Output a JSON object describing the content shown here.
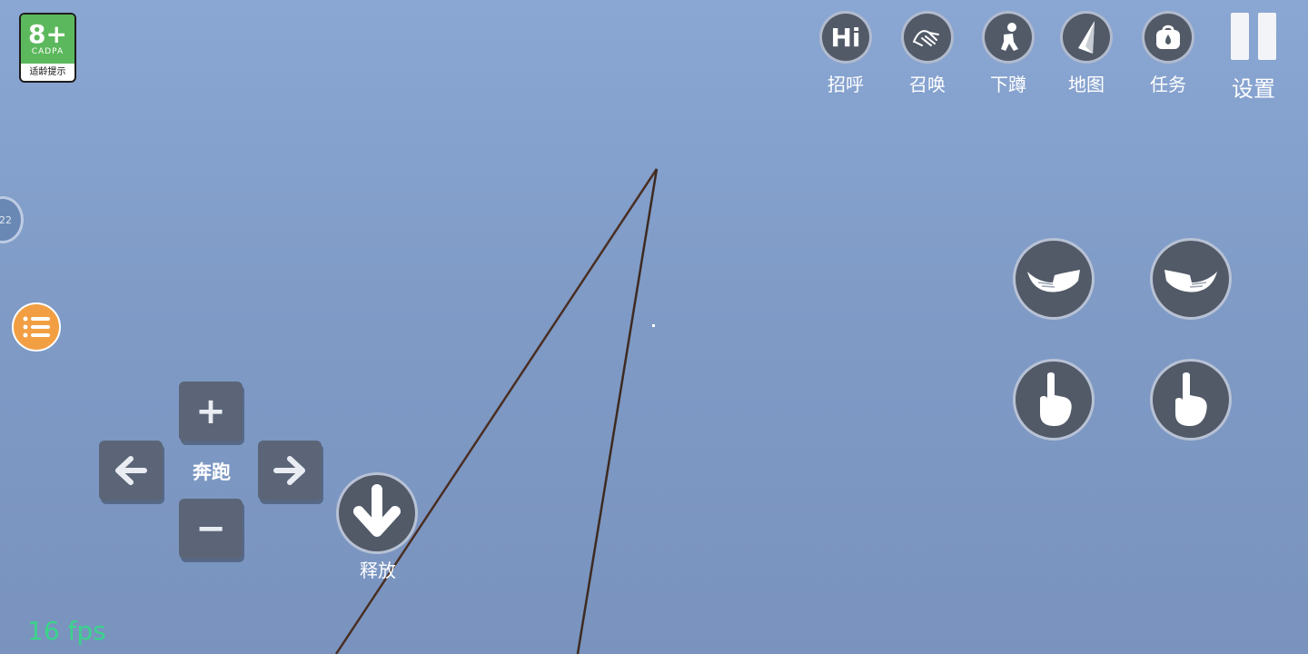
{
  "age_badge": {
    "rating": "8+",
    "org": "CADPA",
    "note": "适龄提示"
  },
  "top_actions": [
    {
      "label": "招呼",
      "icon": "hi-icon",
      "text": "Hi"
    },
    {
      "label": "召唤",
      "icon": "beckon-hand-icon"
    },
    {
      "label": "下蹲",
      "icon": "crouch-icon"
    },
    {
      "label": "地图",
      "icon": "map-arrow-icon"
    },
    {
      "label": "任务",
      "icon": "task-bag-icon"
    }
  ],
  "settings": {
    "label": "设置",
    "icon": "pause-icon"
  },
  "side_indicator": {
    "text": "22"
  },
  "menu": {
    "icon": "list-menu-icon"
  },
  "dpad": {
    "up_symbol": "+",
    "down_symbol": "−",
    "center_label": "奔跑"
  },
  "release": {
    "label": "释放",
    "icon": "arrow-down-icon"
  },
  "hand_buttons": [
    {
      "icon": "left-open-hands-icon"
    },
    {
      "icon": "right-open-hands-icon"
    },
    {
      "icon": "left-point-hand-icon"
    },
    {
      "icon": "right-point-hand-icon"
    }
  ],
  "fps": "16 fps",
  "colors": {
    "menu_accent": "#f29e42",
    "fps_text": "#3ad48a",
    "button_fill": "#525a68"
  }
}
